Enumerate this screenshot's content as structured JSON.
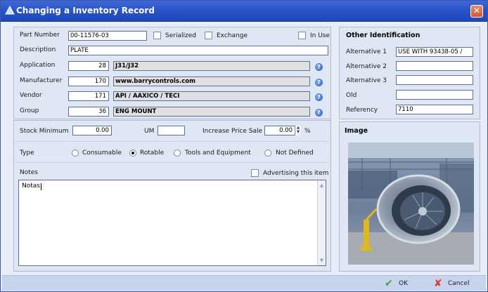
{
  "window": {
    "title": "Changing a Inventory Record",
    "close_label": "✕"
  },
  "record": {
    "part_number": {
      "label": "Part Number",
      "value": "00-11576-03"
    },
    "serialized": {
      "label": "Serialized",
      "checked": false
    },
    "exchange": {
      "label": "Exchange",
      "checked": false
    },
    "in_use": {
      "label": "In Use",
      "checked": false
    },
    "description": {
      "label": "Description",
      "value": "PLATE"
    },
    "application": {
      "label": "Application",
      "code": "28",
      "name": "J31/J32"
    },
    "manufacturer": {
      "label": "Manufacturer",
      "code": "170",
      "name": "www.barrycontrols.com"
    },
    "vendor": {
      "label": "Vendor",
      "code": "171",
      "name": "API / AAXICO / TECI"
    },
    "group": {
      "label": "Group",
      "code": "36",
      "name": "ENG MOUNT"
    }
  },
  "stock": {
    "minimum": {
      "label": "Stock Minimum",
      "value": "0.00"
    },
    "um": {
      "label": "UM",
      "value": ""
    },
    "increase_price": {
      "label": "Increase Price Sale",
      "value": "0.00",
      "unit": "%"
    }
  },
  "type": {
    "label": "Type",
    "options": [
      {
        "label": "Consumable",
        "selected": false
      },
      {
        "label": "Rotable",
        "selected": true
      },
      {
        "label": "Tools and Equipment",
        "selected": false
      },
      {
        "label": "Not Defined",
        "selected": false
      }
    ]
  },
  "notes": {
    "label": "Notes",
    "value": "Notas",
    "advertising": {
      "label": "Advertising this item",
      "checked": false
    }
  },
  "other_identification": {
    "title": "Other Identification",
    "alternative_1": {
      "label": "Alternative 1",
      "value": "USE WITH 93438-05 /"
    },
    "alternative_2": {
      "label": "Alternative 2",
      "value": ""
    },
    "alternative_3": {
      "label": "Alternative 3",
      "value": ""
    },
    "old": {
      "label": "Old",
      "value": ""
    },
    "referency": {
      "label": "Referency",
      "value": "7110"
    }
  },
  "image_panel": {
    "title": "Image"
  },
  "footer": {
    "ok_label": "OK",
    "cancel_label": "Cancel"
  },
  "colors": {
    "title_bar": "#2a55c8",
    "panel": "#dfe6f4",
    "ok_icon": "#3aa832",
    "cancel_icon": "#d83a2a"
  },
  "icons": {
    "title": "app-icon",
    "help": "help-icon",
    "ok": "check-icon",
    "cancel": "cross-icon"
  }
}
